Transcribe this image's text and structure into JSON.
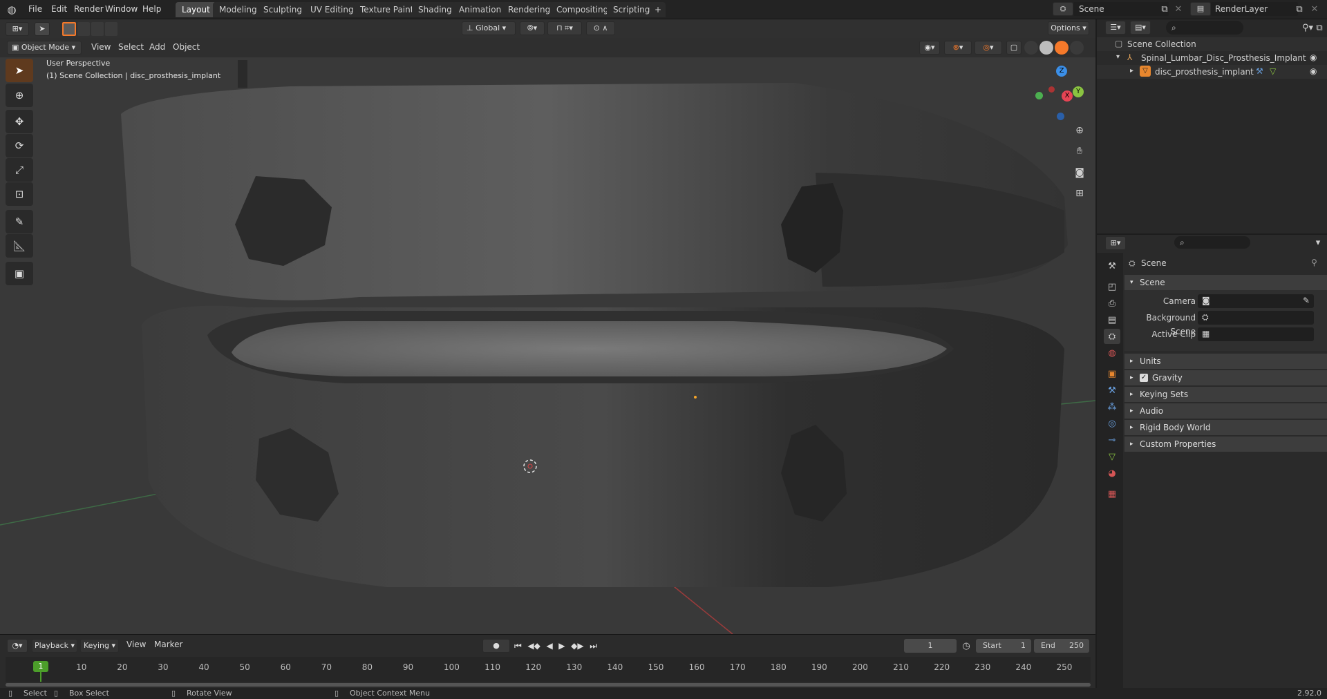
{
  "topbar": {
    "menus": [
      "File",
      "Edit",
      "Render",
      "Window",
      "Help"
    ],
    "workspaces": [
      "Layout",
      "Modeling",
      "Sculpting",
      "UV Editing",
      "Texture Paint",
      "Shading",
      "Animation",
      "Rendering",
      "Compositing",
      "Scripting"
    ],
    "active_workspace": "Layout",
    "add_tab": "+",
    "scene": "Scene",
    "render_layer": "RenderLayer"
  },
  "viewport": {
    "mode": "Object Mode",
    "menus": [
      "View",
      "Select",
      "Add",
      "Object"
    ],
    "transform": "Global",
    "options": "Options",
    "info_line1": "User Perspective",
    "info_line2": "(1) Scene Collection | disc_prosthesis_implant",
    "axes": {
      "x": "X",
      "y": "Y",
      "z": "Z"
    }
  },
  "timeline": {
    "menus": [
      "Playback",
      "Keying",
      "View",
      "Marker"
    ],
    "current_frame": "1",
    "start_label": "Start",
    "start": "1",
    "end_label": "End",
    "end": "250",
    "ticks": [
      "10",
      "20",
      "30",
      "40",
      "50",
      "60",
      "70",
      "80",
      "90",
      "100",
      "110",
      "120",
      "130",
      "140",
      "150",
      "160",
      "170",
      "180",
      "190",
      "200",
      "210",
      "220",
      "230",
      "240",
      "250"
    ],
    "playhead": "1"
  },
  "status": {
    "select": "Select",
    "box_select": "Box Select",
    "rotate_view": "Rotate View",
    "context_menu": "Object Context Menu",
    "version": "2.92.0"
  },
  "outliner": {
    "root": "Scene Collection",
    "items": [
      {
        "label": "Spinal_Lumbar_Disc_Prosthesis_Implant"
      },
      {
        "label": "disc_prosthesis_implant"
      }
    ]
  },
  "properties": {
    "header": "Scene",
    "section": "Scene",
    "camera_label": "Camera",
    "background_label": "Background Scene",
    "clip_label": "Active Clip",
    "panels": [
      "Units",
      "Gravity",
      "Keying Sets",
      "Audio",
      "Rigid Body World",
      "Custom Properties"
    ]
  },
  "colors": {
    "accent": "#f5792a",
    "active_green": "#4c9e2a",
    "x_axis": "#e64454",
    "y_axis": "#8ac341",
    "z_axis": "#3b8fe8"
  }
}
